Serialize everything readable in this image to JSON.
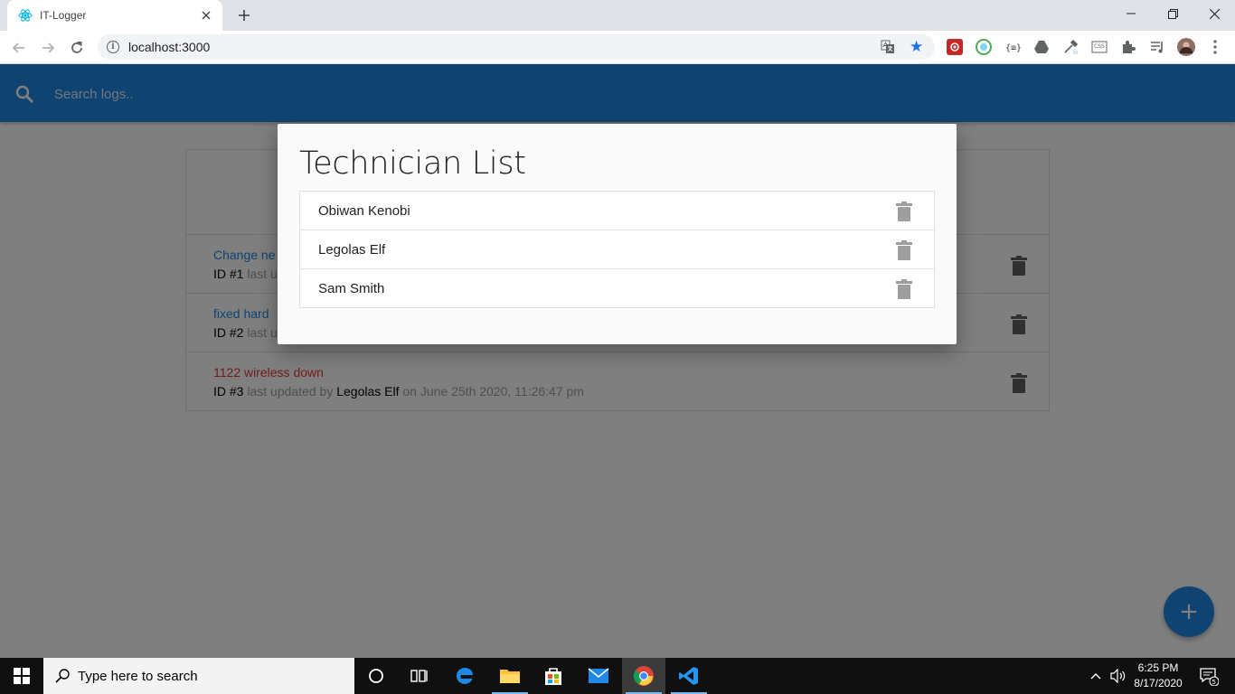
{
  "browser": {
    "tab_title": "IT-Logger",
    "url": "localhost:3000",
    "colors": {
      "tabstrip": "#dee1e6",
      "accent": "#1a73e8"
    }
  },
  "app": {
    "search_placeholder": "Search logs..",
    "colors": {
      "nav": "#1e88e5",
      "attention": "#e53935"
    },
    "logs": [
      {
        "message": "Change ne",
        "id_label": "ID #1",
        "rest": "last u",
        "attention": false
      },
      {
        "message": "fixed hard",
        "id_label": "ID #2",
        "rest": "last u",
        "attention": false
      },
      {
        "message": "1122 wireless down",
        "id_label": "ID #3",
        "last_updated_by": "last updated by",
        "tech": "Legolas Elf",
        "on": "on June 25th 2020, 11:26:47 pm",
        "attention": true
      }
    ],
    "fab_icon": "+"
  },
  "modal": {
    "title": "Technician List",
    "technicians": [
      {
        "name": "Obiwan Kenobi"
      },
      {
        "name": "Legolas Elf"
      },
      {
        "name": "Sam Smith"
      }
    ]
  },
  "taskbar": {
    "search_placeholder": "Type here to search",
    "time": "6:25 PM",
    "date": "8/17/2020",
    "notification_count": "5"
  }
}
